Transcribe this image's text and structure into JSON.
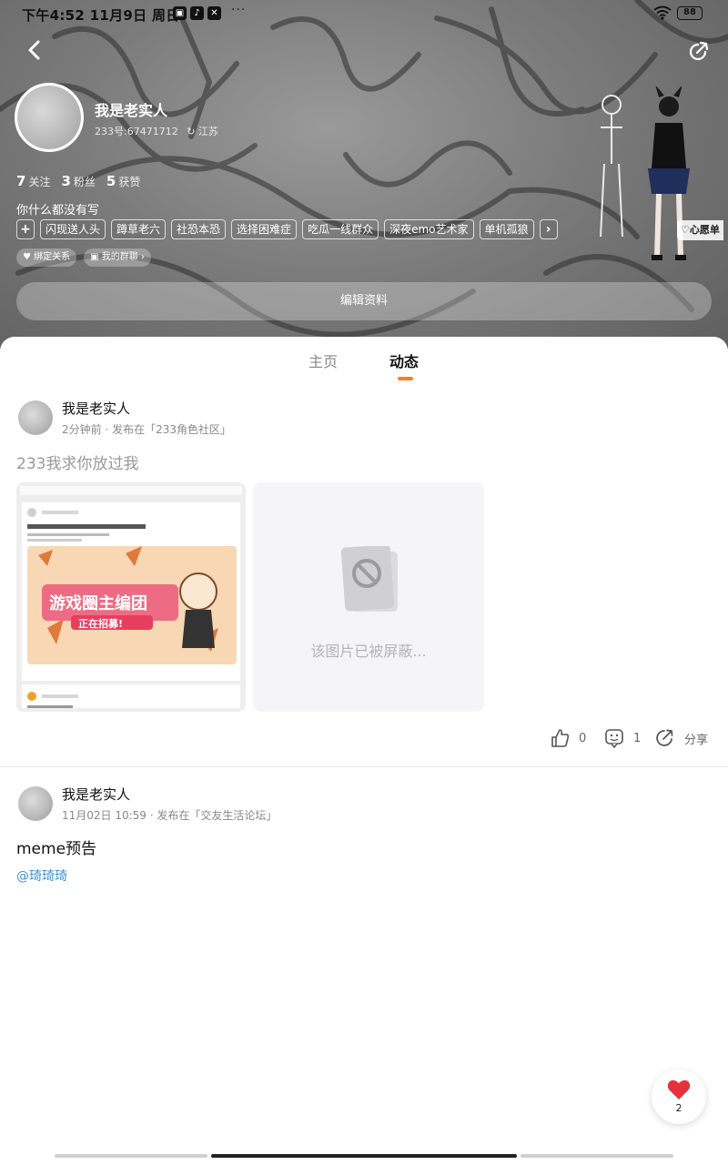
{
  "status": {
    "time": "下午4:52  11月9日  周日",
    "battery": "88"
  },
  "profile": {
    "name": "我是老实人",
    "id_line": "233号:67471712",
    "location": "江苏",
    "following_count": "7",
    "following_label": "关注",
    "fans_count": "3",
    "fans_label": "粉丝",
    "likes_count": "5",
    "likes_label": "获赞",
    "bio": "你什么都没有写",
    "tags": [
      "闪现送人头",
      "蹲草老六",
      "社恐本恐",
      "选择困难症",
      "吃瓜一线群众",
      "深夜emo艺术家",
      "单机孤狼"
    ],
    "chip_bind": "绑定关系",
    "chip_group": "我的群聊",
    "wishlist": "心愿单",
    "edit_button": "编辑资料"
  },
  "tabs": {
    "home": "主页",
    "feed": "动态"
  },
  "posts": [
    {
      "author": "我是老实人",
      "meta": "2分钟前 · 发布在「233角色社区」",
      "text": "233我求你放过我",
      "blocked_text": "该图片已被屏蔽...",
      "likes": "0",
      "comments": "1",
      "share": "分享"
    },
    {
      "author": "我是老实人",
      "meta": "11月02日 10:59 · 发布在「交友生活论坛」",
      "text": "meme预告",
      "mention": "@琦琦琦"
    }
  ],
  "thumb": {
    "banner_title": "游戏圈主编团",
    "banner_sub": "正在招募!"
  },
  "like_fab": {
    "count": "2"
  },
  "colors": {
    "accent": "#ff7a1a",
    "mention": "#3a8fd6",
    "heart": "#e8303a"
  }
}
